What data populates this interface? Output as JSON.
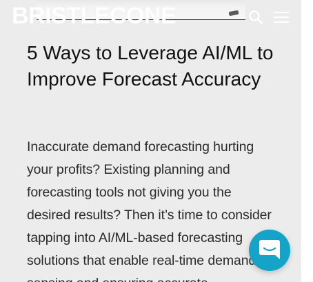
{
  "header": {
    "logo_text": "BRISTLECONE",
    "search_icon": "search-icon",
    "menu_icon": "hamburger-menu-icon"
  },
  "article": {
    "title": "5 Ways to Leverage AI/ML to Improve Forecast Accuracy",
    "intro": "Inaccurate demand forecasting hurting your profits? Existing planning and forecasting tools not giving you the desired results? Then it’s time to consider tapping into AI/ML-based forecasting solutions that enable real-time demand sensing and ensuring accurate"
  },
  "chat_widget": {
    "icon": "chat-bubble-icon",
    "color": "#16a3c8"
  },
  "colors": {
    "page_background": "#ececec",
    "title_text": "#111111",
    "body_text": "#2a2a2a",
    "logo": "#ffffff"
  }
}
